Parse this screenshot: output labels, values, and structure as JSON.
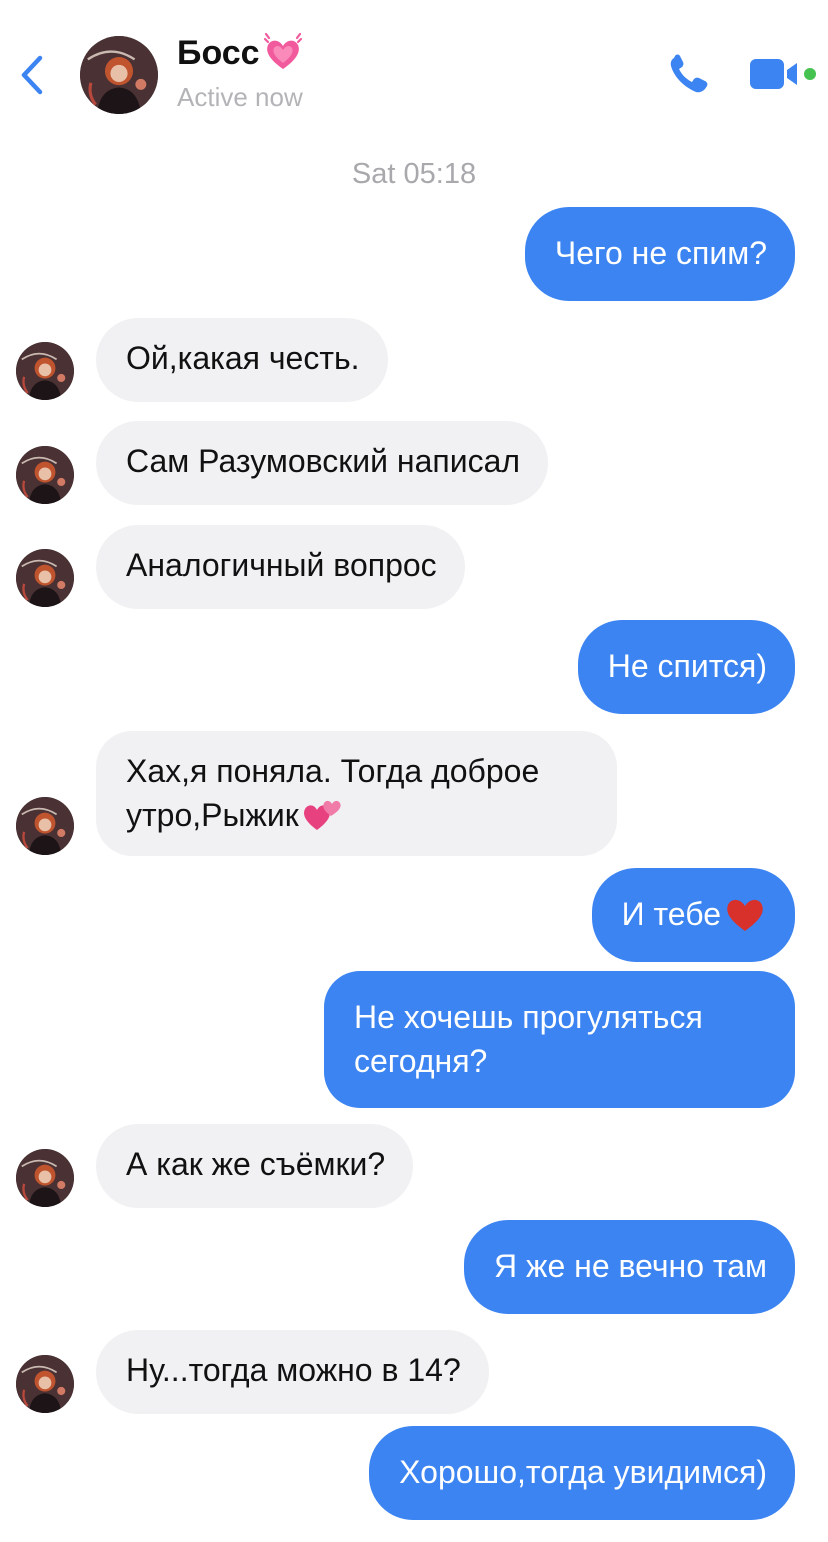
{
  "header": {
    "contact_name": "Босс",
    "status": "Active now"
  },
  "timestamp": "Sat 05:18",
  "messages": [
    {
      "from": "me",
      "text": "Чего не спим?"
    },
    {
      "from": "them",
      "text": "Ой,какая честь."
    },
    {
      "from": "them",
      "text": "Сам Разумовский написал"
    },
    {
      "from": "them",
      "text": "Аналогичный вопрос"
    },
    {
      "from": "me",
      "text": "Не спится)"
    },
    {
      "from": "them",
      "line1": "Хах,я поняла. Тогда доброе",
      "line2": "утро,Рыжик",
      "emoji": "two-hearts-icon"
    },
    {
      "from": "me",
      "text": "И тебе",
      "emoji": "red-heart-icon"
    },
    {
      "from": "me",
      "line1": "Не хочешь прогуляться",
      "line2": "сегодня?"
    },
    {
      "from": "them",
      "text": "А как же съёмки?"
    },
    {
      "from": "me",
      "text": "Я же не вечно там"
    },
    {
      "from": "them",
      "text": "Ну...тогда можно в 14?"
    },
    {
      "from": "me",
      "text": "Хорошо,тогда увидимся)"
    }
  ],
  "colors": {
    "outgoing_bubble": "#3b84f2",
    "incoming_bubble": "#f1f1f3",
    "accent": "#3b84f2",
    "active_dot": "#45c24f"
  }
}
